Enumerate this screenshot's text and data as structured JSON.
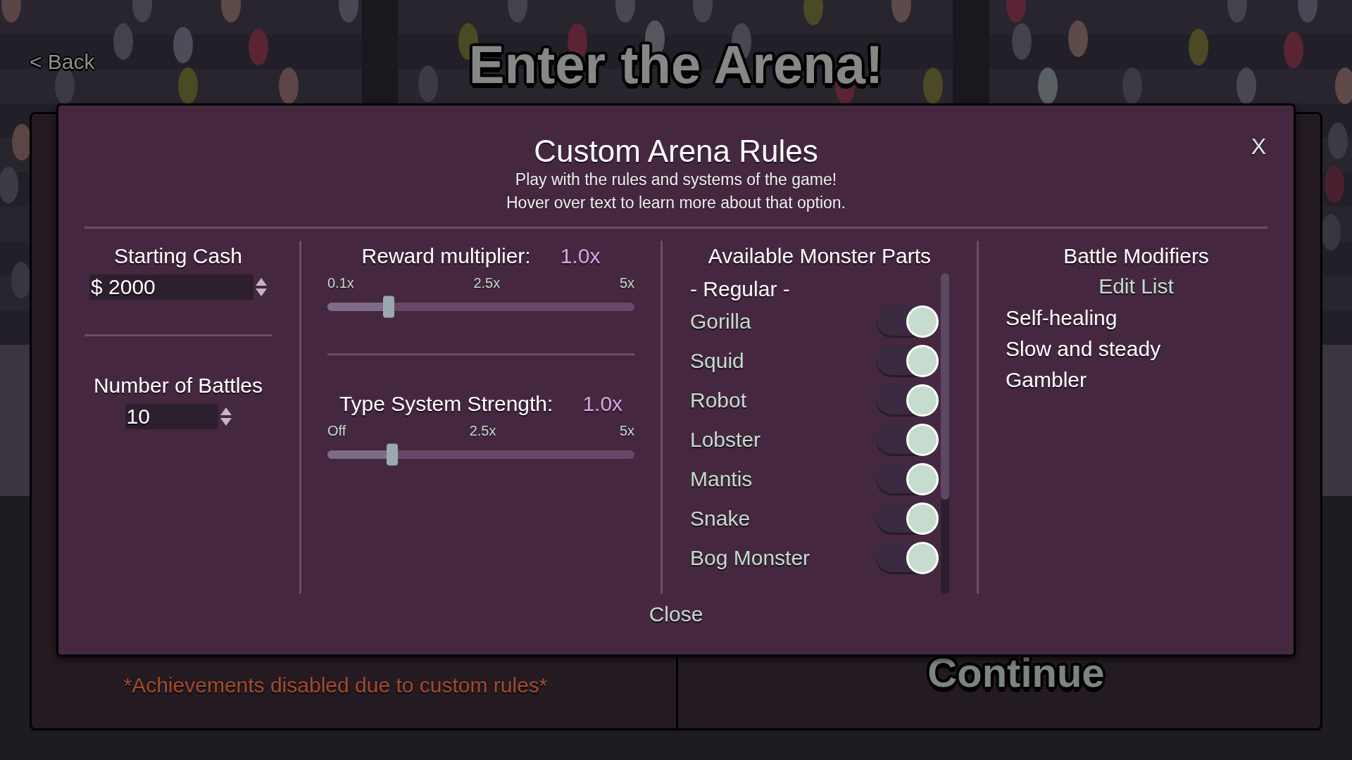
{
  "header": {
    "back_link": "< Back",
    "title": "Enter the Arena!"
  },
  "menu_panel": {
    "note": "*Achievements disabled due to custom rules*",
    "continue": "Continue"
  },
  "dialog": {
    "title": "Custom Arena Rules",
    "subtitle_lines": [
      "Play with the rules and systems of the game!",
      "Hover over text to learn more about that option."
    ],
    "close_icon": "X",
    "settings": [
      {
        "label": "Starting Cash",
        "value": "$ 2000"
      },
      {
        "label": "Number of Battles",
        "value": "10"
      }
    ],
    "sliders": [
      {
        "label": "Reward multiplier:",
        "reading": "1.0x",
        "ticks": [
          "0.1x",
          "2.5x",
          "5x"
        ],
        "level": 0.2
      },
      {
        "label": "Type System Strength:",
        "reading": "1.0x",
        "ticks": [
          "Off",
          "2.5x",
          "5x"
        ],
        "level": 0.21
      }
    ],
    "monster_parts": {
      "title": "Available Monster Parts",
      "items": [
        {
          "kind": "heading",
          "text": "- Regular -"
        },
        {
          "kind": "toggle",
          "label": "Gorilla",
          "on": true
        },
        {
          "kind": "toggle",
          "label": "Squid",
          "on": true
        },
        {
          "kind": "toggle",
          "label": "Robot",
          "on": true
        },
        {
          "kind": "toggle",
          "label": "Lobster",
          "on": true
        },
        {
          "kind": "toggle",
          "label": "Mantis",
          "on": true
        },
        {
          "kind": "toggle",
          "label": "Snake",
          "on": true
        },
        {
          "kind": "toggle",
          "label": "Bog Monster",
          "on": true
        }
      ]
    },
    "battle_modifiers": {
      "title": "Battle Modifiers",
      "edit_link": "Edit List",
      "items": [
        "Self-healing",
        "Slow and steady",
        "Gambler"
      ]
    },
    "close_button": "Close"
  }
}
